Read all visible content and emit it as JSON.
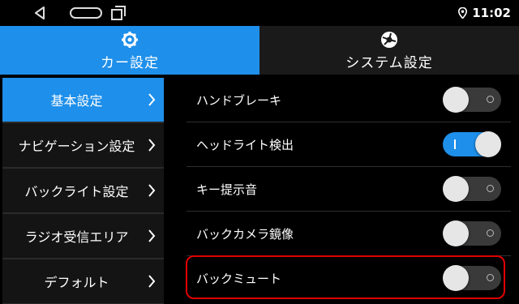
{
  "statusbar": {
    "time": "11:02",
    "icons": [
      "back-icon",
      "home-icon",
      "recent-apps-icon",
      "location-icon"
    ]
  },
  "tabs": [
    {
      "label": "カー設定",
      "icon": "gear-icon",
      "active": true
    },
    {
      "label": "システム設定",
      "icon": "system-settings-icon",
      "active": false
    }
  ],
  "sidebar": {
    "items": [
      {
        "label": "基本設定",
        "active": true
      },
      {
        "label": "ナビゲーション設定",
        "active": false
      },
      {
        "label": "バックライト設定",
        "active": false
      },
      {
        "label": "ラジオ受信エリア",
        "active": false
      },
      {
        "label": "デフォルト",
        "active": false
      }
    ]
  },
  "settings": {
    "rows": [
      {
        "label": "ハンドブレーキ",
        "state": "off"
      },
      {
        "label": "ヘッドライト検出",
        "state": "on"
      },
      {
        "label": "キー提示音",
        "state": "off"
      },
      {
        "label": "バックカメラ鏡像",
        "state": "off"
      },
      {
        "label": "バックミュート",
        "state": "off",
        "highlighted": true
      }
    ]
  },
  "colors": {
    "accent": "#1e8fea",
    "highlight": "#e00000",
    "background": "#000000"
  }
}
